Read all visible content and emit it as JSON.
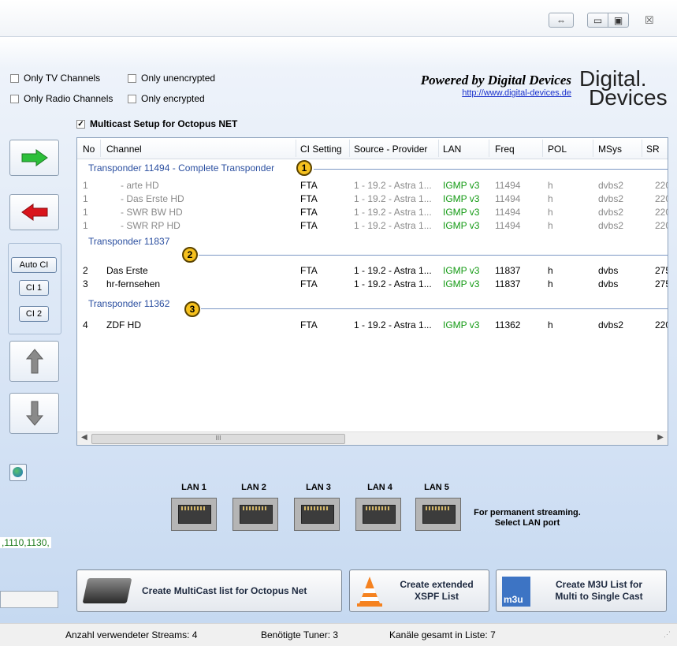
{
  "filters": {
    "only_tv": "Only TV Channels",
    "only_radio": "Only Radio Channels",
    "only_unencrypted": "Only unencrypted",
    "only_encrypted": "Only encrypted",
    "multicast_setup": "Multicast Setup for Octopus NET"
  },
  "branding": {
    "powered_by": "Powered by Digital Devices",
    "url": "http://www.digital-devices.de",
    "logo_line1": "Digital.",
    "logo_line2": "Devices"
  },
  "ci_buttons": {
    "auto": "Auto CI",
    "ci1": "CI 1",
    "ci2": "CI 2"
  },
  "columns": [
    "No",
    "Channel",
    "CI Setting",
    "Source - Provider",
    "LAN",
    "Freq",
    "POL",
    "MSys",
    "SR"
  ],
  "groups": [
    {
      "label": "Transponder 11494 - Complete Transponder",
      "badge": "1"
    },
    {
      "label": "Transponder 11837",
      "badge": "2"
    },
    {
      "label": "Transponder 11362",
      "badge": "3"
    }
  ],
  "rows": [
    {
      "no": "1",
      "channel": "- arte HD",
      "ci": "FTA",
      "source": "1 - 19.2 - Astra 1...",
      "lan": "IGMP v3",
      "freq": "11494",
      "pol": "h",
      "msys": "dvbs2",
      "sr": "220"
    },
    {
      "no": "1",
      "channel": "- Das Erste HD",
      "ci": "FTA",
      "source": "1 - 19.2 - Astra 1...",
      "lan": "IGMP v3",
      "freq": "11494",
      "pol": "h",
      "msys": "dvbs2",
      "sr": "220"
    },
    {
      "no": "1",
      "channel": "- SWR BW HD",
      "ci": "FTA",
      "source": "1 - 19.2 - Astra 1...",
      "lan": "IGMP v3",
      "freq": "11494",
      "pol": "h",
      "msys": "dvbs2",
      "sr": "220"
    },
    {
      "no": "1",
      "channel": "- SWR RP HD",
      "ci": "FTA",
      "source": "1 - 19.2 - Astra 1...",
      "lan": "IGMP v3",
      "freq": "11494",
      "pol": "h",
      "msys": "dvbs2",
      "sr": "220"
    },
    {
      "no": "2",
      "channel": "Das Erste",
      "ci": "FTA",
      "source": "1 - 19.2 - Astra 1...",
      "lan": "IGMP v3",
      "freq": "11837",
      "pol": "h",
      "msys": "dvbs",
      "sr": "275"
    },
    {
      "no": "3",
      "channel": "hr-fernsehen",
      "ci": "FTA",
      "source": "1 - 19.2 - Astra 1...",
      "lan": "IGMP v3",
      "freq": "11837",
      "pol": "h",
      "msys": "dvbs",
      "sr": "275"
    },
    {
      "no": "4",
      "channel": "ZDF HD",
      "ci": "FTA",
      "source": "1 - 19.2 - Astra 1...",
      "lan": "IGMP v3",
      "freq": "11362",
      "pol": "h",
      "msys": "dvbs2",
      "sr": "220"
    }
  ],
  "lan_ports": [
    "LAN  1",
    "LAN 2",
    "LAN 3",
    "LAN 4",
    "LAN 5"
  ],
  "lan_hint": "For permanent streaming.\nSelect LAN port",
  "left_text": ",1110,1130,",
  "actions": {
    "multicast": "Create MultiCast list for Octopus Net",
    "xspf": "Create extended\nXSPF List",
    "m3u": "Create M3U List for\nMulti to Single Cast",
    "m3u_icon_text": "m3u"
  },
  "status": {
    "streams": "Anzahl verwendeter Streams:  4",
    "tuner": "Benötigte Tuner:  3",
    "channels": "Kanäle gesamt in Liste:  7"
  },
  "colors": {
    "accent": "#2b4fa0",
    "lan_green": "#139a13",
    "badge": "#f6c11e"
  }
}
